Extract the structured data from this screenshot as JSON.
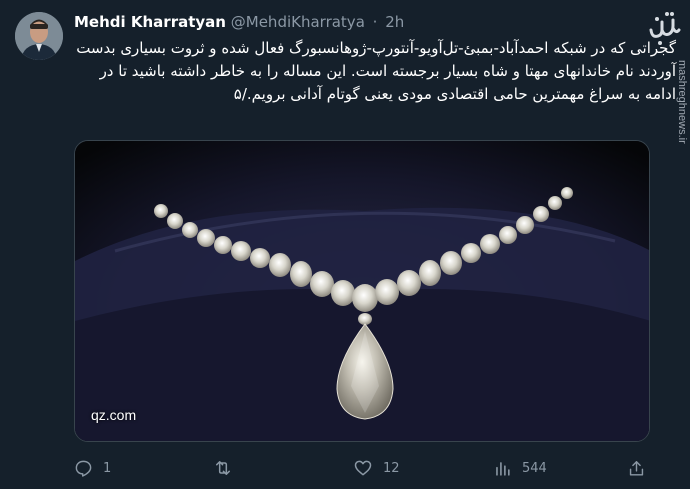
{
  "tweet": {
    "author": {
      "display_name": "Mehdi Kharratyan",
      "handle": "@MehdiKharratya",
      "separator": "·",
      "time": "2h"
    },
    "text": "گجراتی که در شبکه احمدآباد-بمبئ-تل‌آویو-آنتورپ-ژوهانسبورگ فعال شده و ثروت بسیاری بدست آوردند نام خاندانهای مهتا و شاه بسیار برجسته است. این مساله را به خاطر داشته باشید تا در ادامه به سراغ مهمترین حامی اقتصادی مودی یعنی گوتام آدانی برویم./۵",
    "media": {
      "source": "qz.com",
      "subject": "diamond necklace on dark velvet cushion"
    },
    "actions": {
      "reply_count": "1",
      "retweet_count": "",
      "like_count": "12",
      "views_count": "544"
    }
  },
  "watermark": {
    "url": "mashreghnews.ir"
  },
  "colors": {
    "background": "#15202b",
    "secondary_text": "#8b98a5",
    "border": "#38444d"
  }
}
